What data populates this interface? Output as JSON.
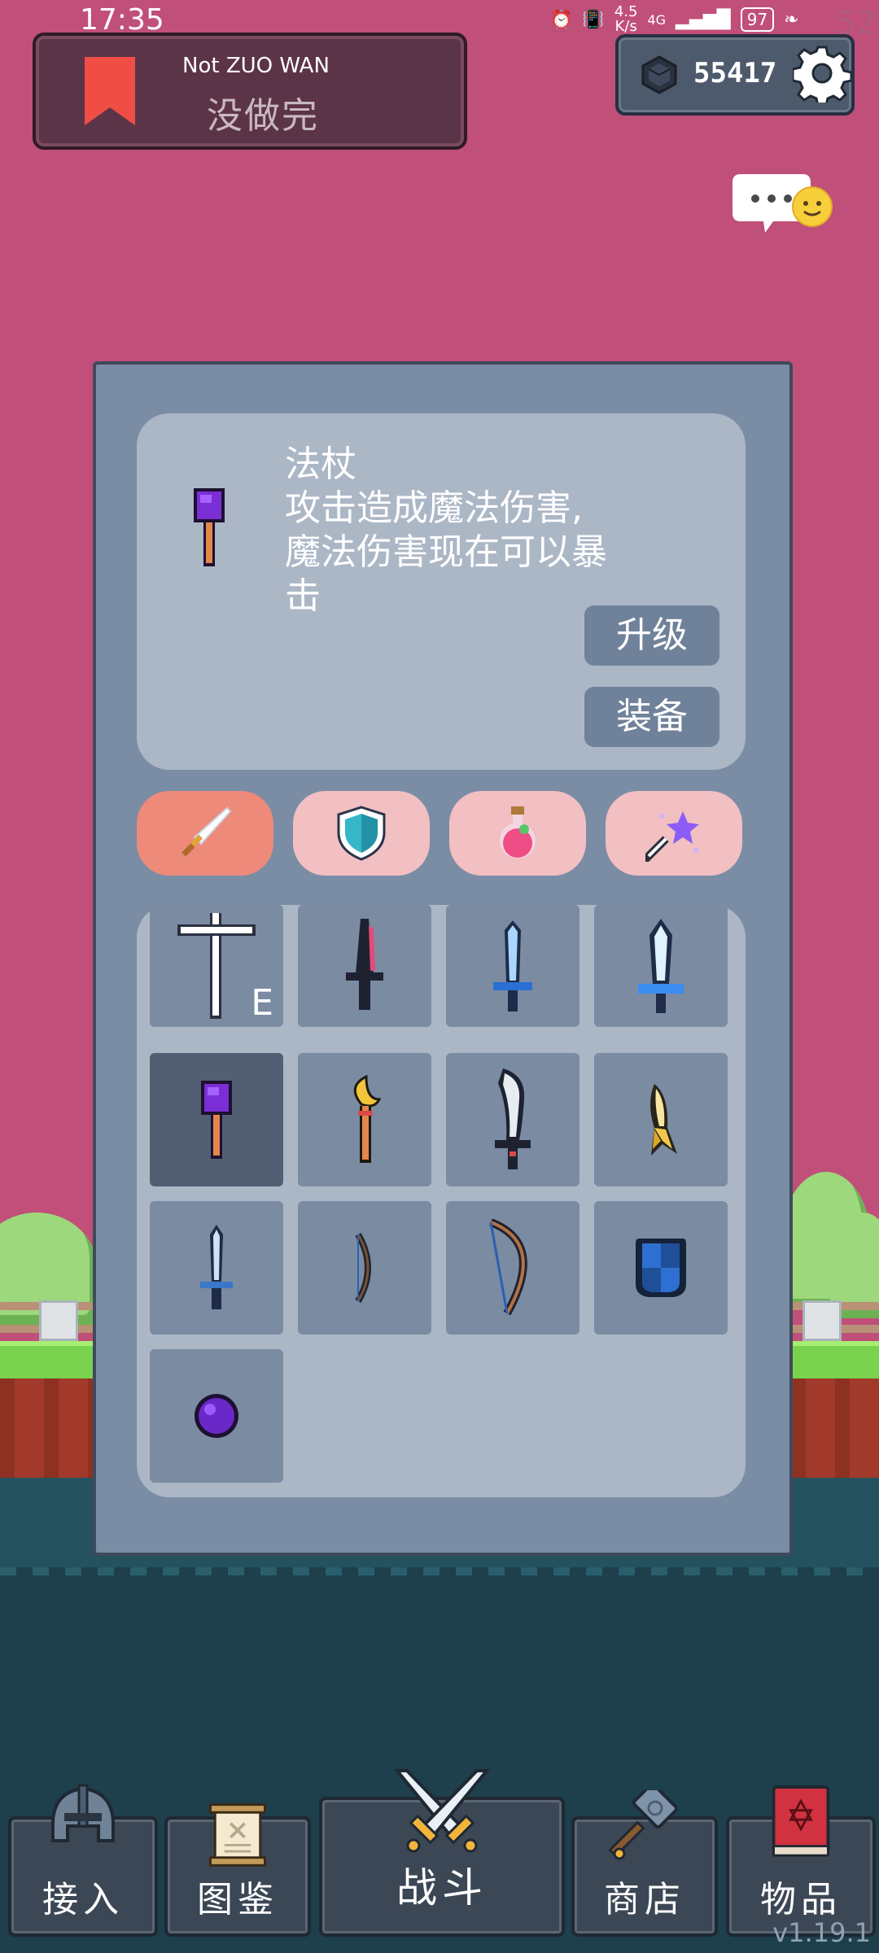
{
  "status_bar": {
    "time": "17:35",
    "net_speed_value": "4.5",
    "net_speed_unit": "K/s",
    "network": "4G",
    "battery": "97",
    "faint_number": "52"
  },
  "quest": {
    "subtitle": "Not ZUO WAN",
    "title": "没做完",
    "bookmark_color": "#f04e45"
  },
  "currency": {
    "amount": "55417"
  },
  "item_detail": {
    "icon": "purple-staff-icon",
    "lines": [
      "法杖",
      "攻击造成魔法伤害,",
      "魔法伤害现在可以暴",
      "击"
    ],
    "upgrade_label": "升级",
    "equip_label": "装备"
  },
  "categories": [
    {
      "name": "weapons",
      "icon": "sword-icon",
      "active": true
    },
    {
      "name": "armor",
      "icon": "shield-icon",
      "active": false
    },
    {
      "name": "potions",
      "icon": "potion-icon",
      "active": false
    },
    {
      "name": "magic",
      "icon": "magic-wand-icon",
      "active": false
    }
  ],
  "inventory": [
    {
      "icon": "white-cross-sword-icon",
      "tag": "E",
      "selected": false
    },
    {
      "icon": "dark-dagger-icon",
      "tag": "",
      "selected": false
    },
    {
      "icon": "blue-sword-icon",
      "tag": "",
      "selected": false
    },
    {
      "icon": "ice-sword-icon",
      "tag": "",
      "selected": false
    },
    {
      "icon": "purple-staff-icon",
      "tag": "",
      "selected": true
    },
    {
      "icon": "moon-staff-icon",
      "tag": "",
      "selected": false
    },
    {
      "icon": "machete-icon",
      "tag": "",
      "selected": false
    },
    {
      "icon": "banana-icon",
      "tag": "",
      "selected": false
    },
    {
      "icon": "short-sword-icon",
      "tag": "",
      "selected": false
    },
    {
      "icon": "small-bow-icon",
      "tag": "",
      "selected": false
    },
    {
      "icon": "long-bow-icon",
      "tag": "",
      "selected": false
    },
    {
      "icon": "blue-shield-icon",
      "tag": "",
      "selected": false
    },
    {
      "icon": "purple-orb-icon",
      "tag": "",
      "selected": false
    }
  ],
  "nav": {
    "join": "接入",
    "codex": "图鉴",
    "battle": "战斗",
    "shop": "商店",
    "items": "物品"
  },
  "version": "v1.19.1",
  "colors": {
    "sky": "#c04f7a",
    "panel": "#7a8da5",
    "card": "#acb7c6",
    "button": "#6f829a",
    "tab_active": "#ee8a7a",
    "tab_inactive": "#f2bfc2",
    "grass": "#79d34e",
    "water": "#1e3f4c"
  }
}
